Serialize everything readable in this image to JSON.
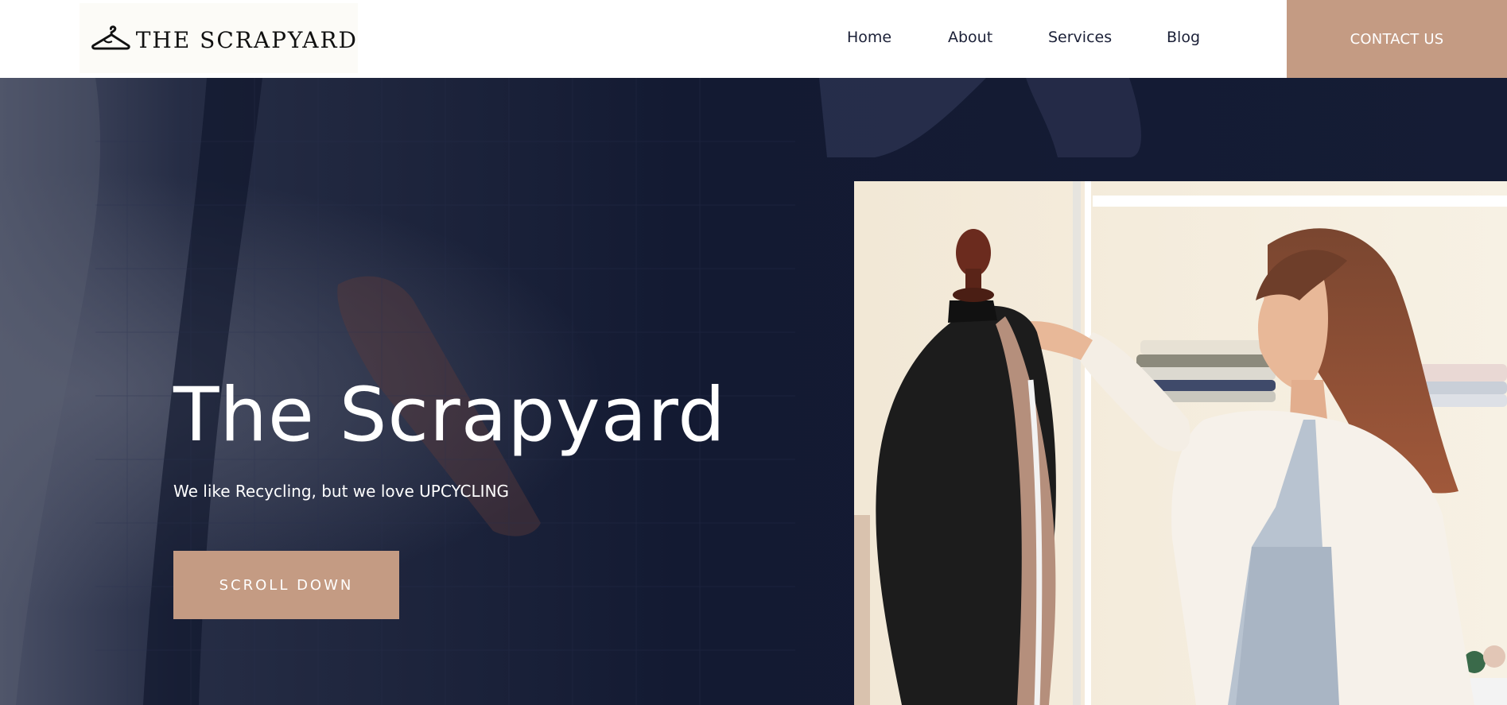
{
  "brand": {
    "logo_text": "THE SCRAPYARD",
    "logo_icon": "hanger-icon"
  },
  "nav": {
    "items": [
      {
        "label": "Home"
      },
      {
        "label": "About"
      },
      {
        "label": "Services"
      },
      {
        "label": "Blog"
      }
    ],
    "contact_label": "CONTACT US"
  },
  "hero": {
    "title": "The Scrapyard",
    "subtitle": "We like Recycling, but we love UPCYCLING",
    "cta_label": "SCROLL DOWN"
  },
  "colors": {
    "accent": "#c49b83",
    "hero_background": "#141b33",
    "nav_text": "#1b2037"
  }
}
